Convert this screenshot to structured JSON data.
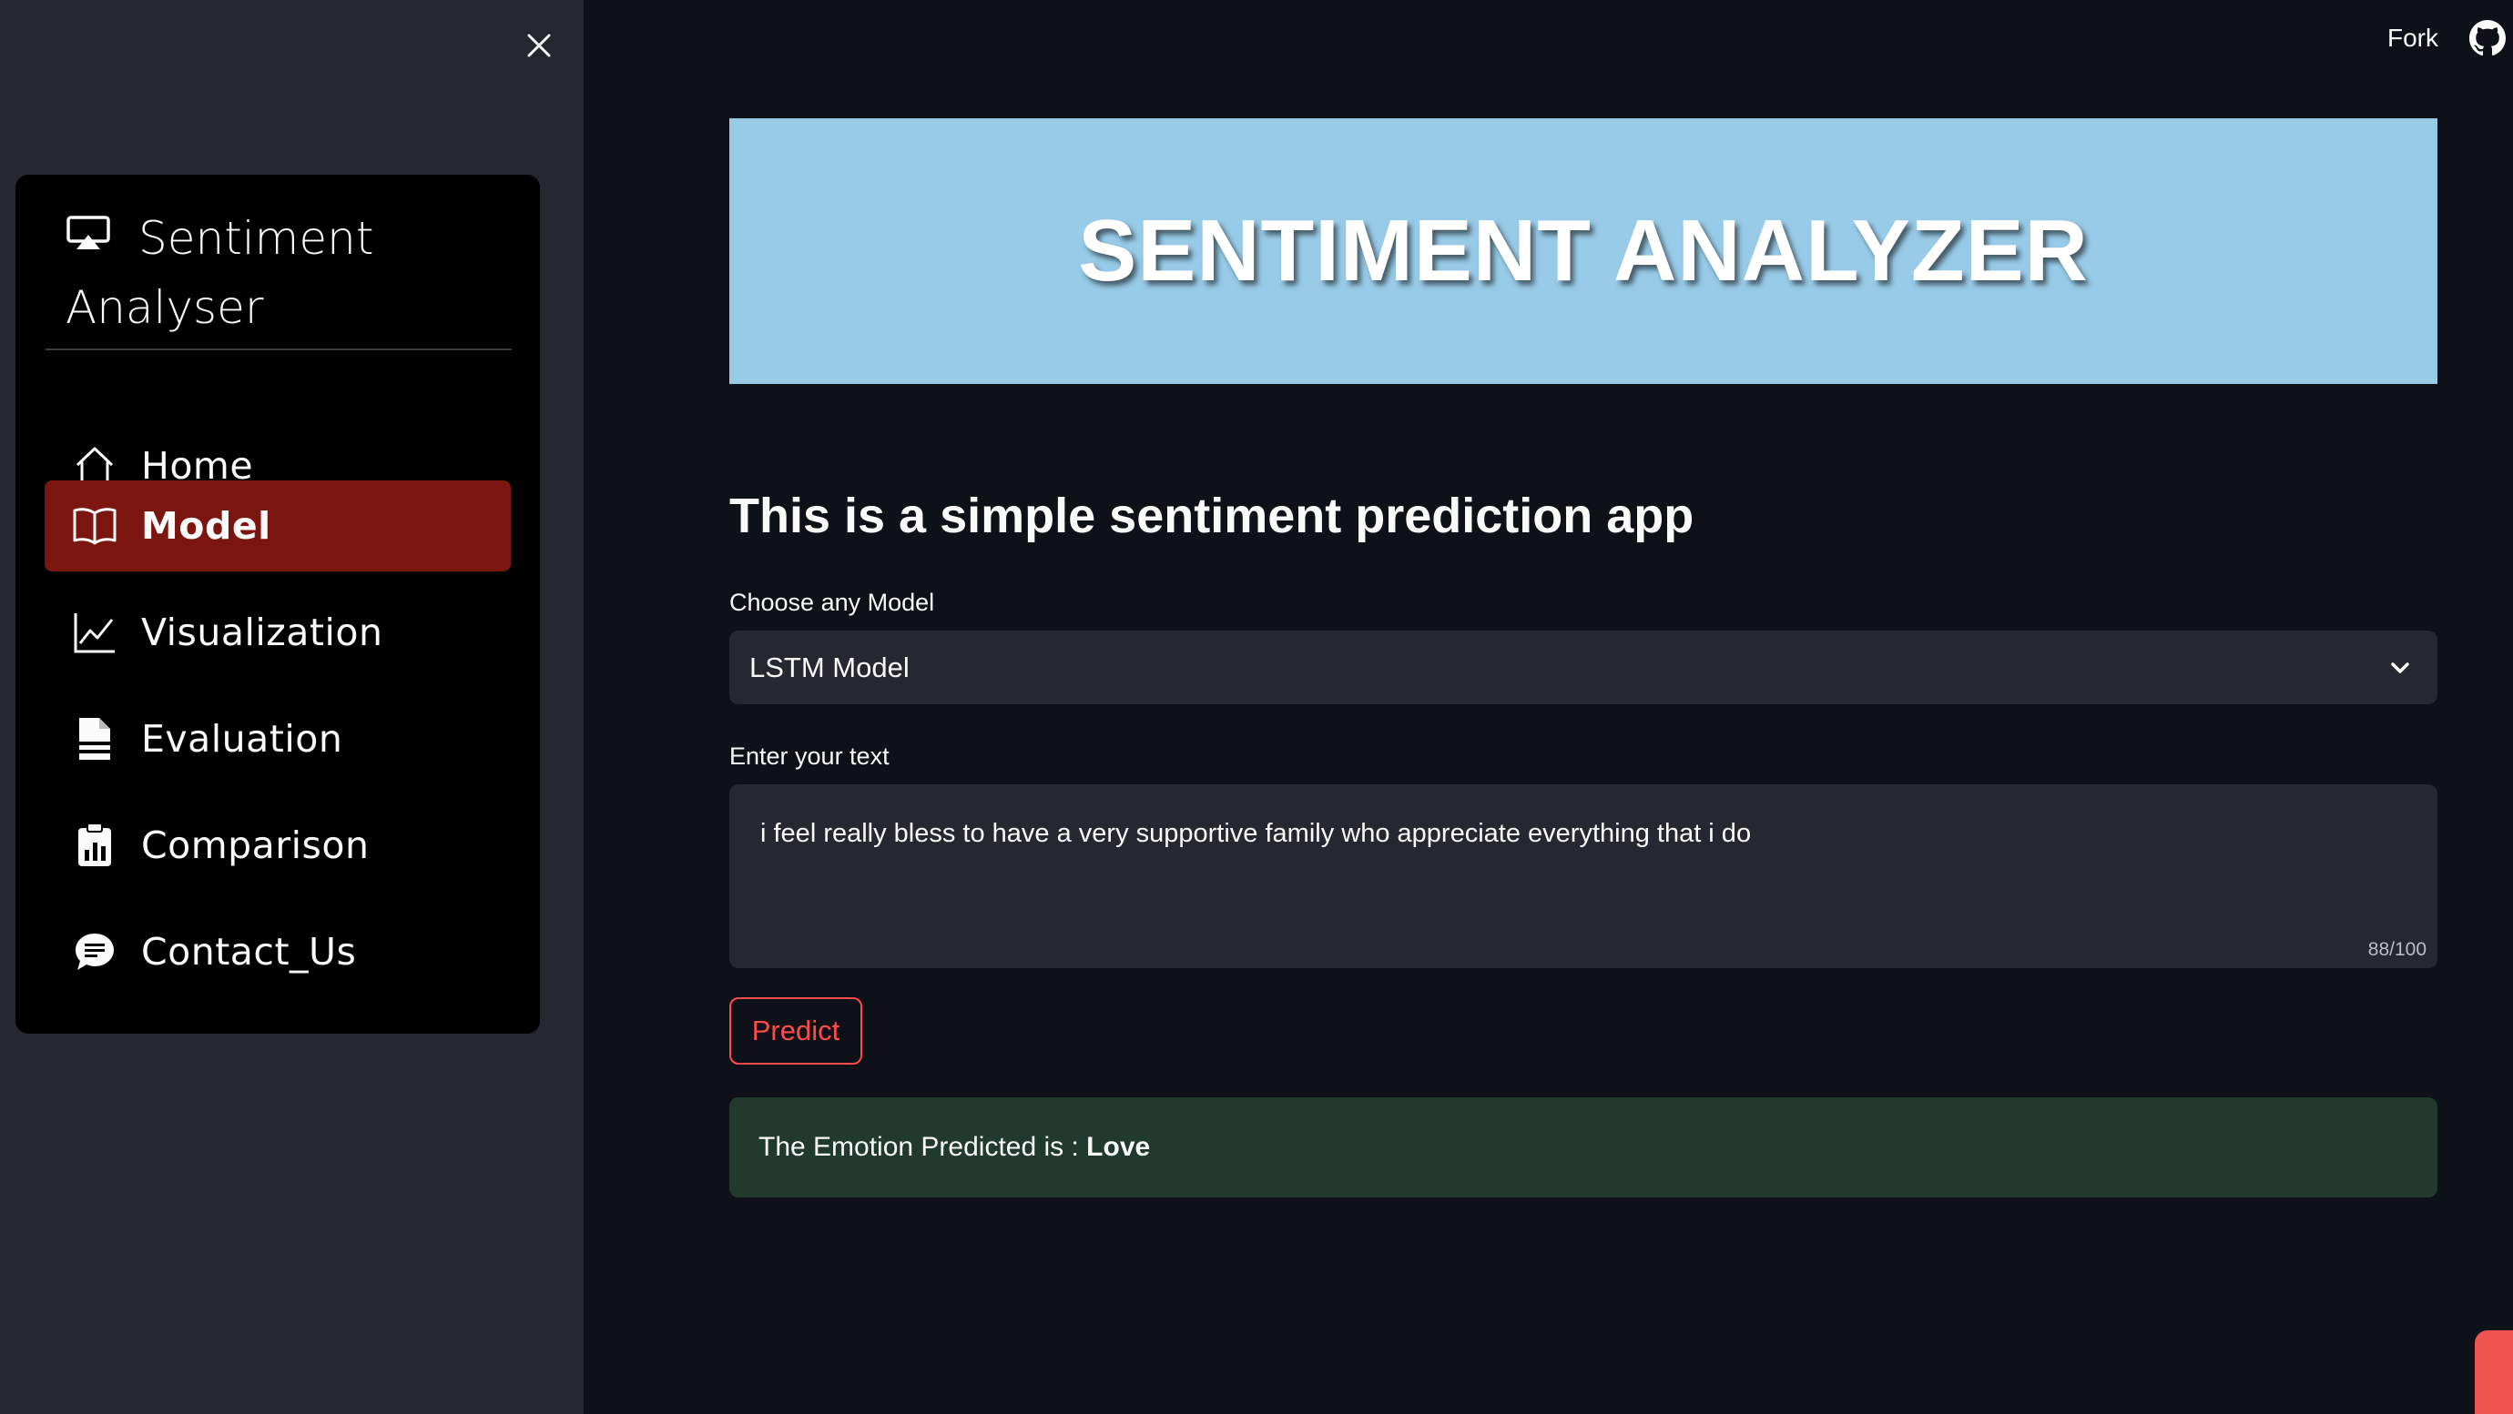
{
  "sidebar": {
    "close_icon": "close-icon",
    "menu_title": "Sentiment Analyser",
    "menu_icon": "airplay-icon",
    "items": [
      {
        "label": "Home",
        "icon": "home-icon",
        "active": false
      },
      {
        "label": "Model",
        "icon": "book-icon",
        "active": true
      },
      {
        "label": "Visualization",
        "icon": "graph-up-icon",
        "active": false
      },
      {
        "label": "Evaluation",
        "icon": "file-earmark-icon",
        "active": false
      },
      {
        "label": "Comparison",
        "icon": "clipboard-data-icon",
        "active": false
      },
      {
        "label": "Contact_Us",
        "icon": "chat-icon",
        "active": false
      }
    ]
  },
  "topbar": {
    "fork_label": "Fork",
    "github_icon": "github-icon"
  },
  "main": {
    "banner_title": "SENTIMENT ANALYZER",
    "subheading": "This is a simple sentiment prediction app",
    "model_select": {
      "label": "Choose any Model",
      "value": "LSTM Model"
    },
    "text_input": {
      "label": "Enter your text",
      "value": "i feel really bless to have a very supportive family who appreciate everything that i do",
      "counter": "88/100"
    },
    "predict_label": "Predict",
    "result": {
      "prefix": "The Emotion Predicted is : ",
      "emotion": "Love"
    }
  },
  "colors": {
    "accent": "#ff4b4b",
    "active_menu": "#7a1510",
    "banner_bg": "#98cbe8",
    "success_bg": "#213a2d"
  }
}
